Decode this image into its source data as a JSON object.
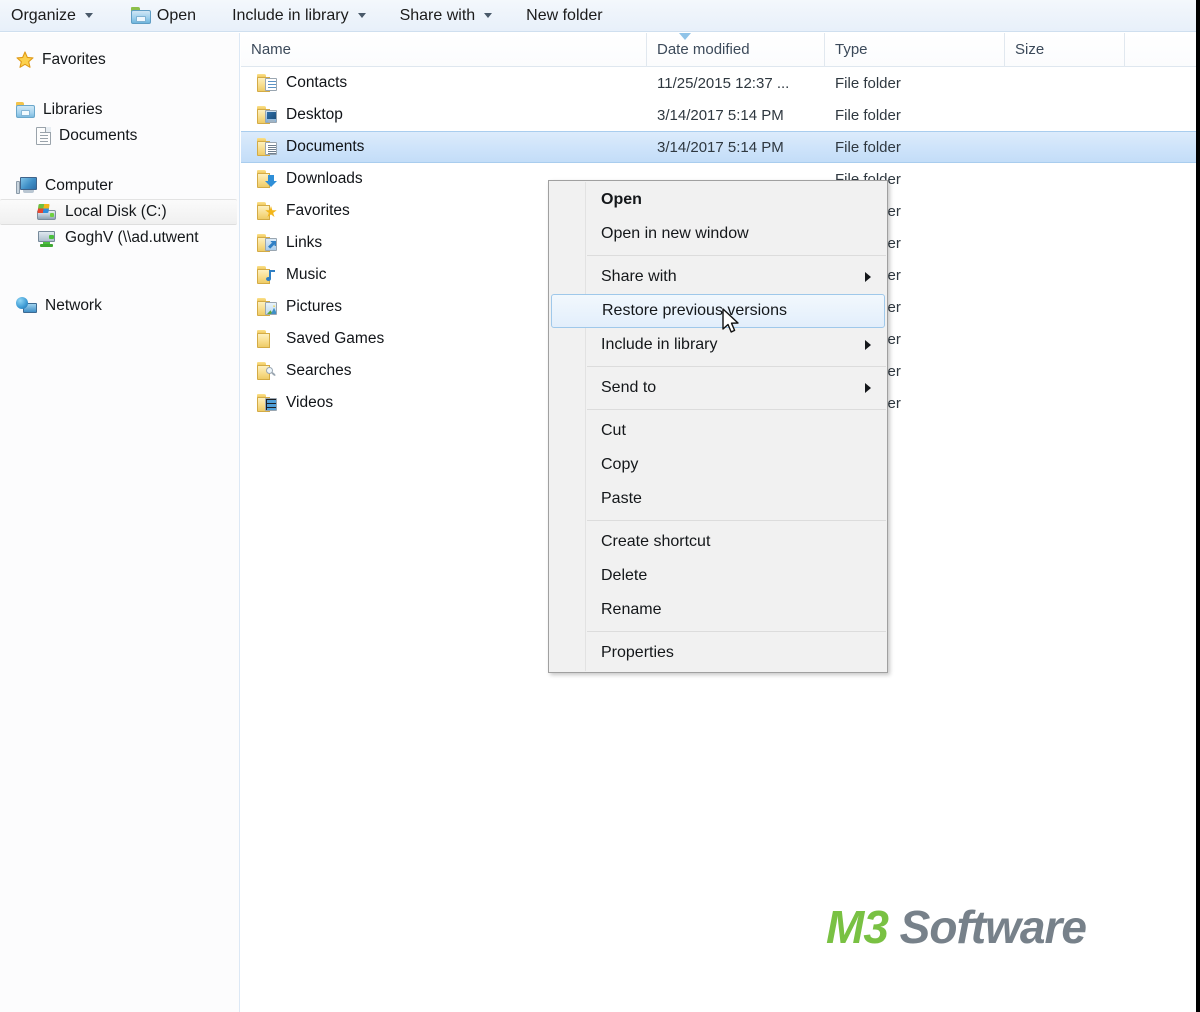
{
  "toolbar": {
    "items": [
      {
        "label": "Organize",
        "caret": true,
        "icon": null
      },
      {
        "label": "Open",
        "caret": false,
        "icon": "open-folder-icon"
      },
      {
        "label": "Include in library",
        "caret": true,
        "icon": null
      },
      {
        "label": "Share with",
        "caret": true,
        "icon": null
      },
      {
        "label": "New folder",
        "caret": false,
        "icon": null
      }
    ]
  },
  "sidebar": {
    "groups": [
      {
        "label": "Favorites",
        "icon": "star-icon",
        "selected": false
      },
      {
        "label": "Libraries",
        "icon": "library-folder-icon",
        "selected": false
      },
      {
        "label": "Documents",
        "icon": "document-icon",
        "selected": false,
        "child": true
      },
      {
        "label": "Computer",
        "icon": "computer-icon",
        "selected": false
      },
      {
        "label": "Local Disk (C:)",
        "icon": "hard-drive-icon",
        "selected": true,
        "child": true
      },
      {
        "label": "GoghV (\\\\ad.utwent",
        "icon": "network-drive-icon",
        "selected": false,
        "child": true
      },
      {
        "label": "Network",
        "icon": "network-globe-icon",
        "selected": false
      }
    ]
  },
  "list": {
    "columns": [
      {
        "label": "Name",
        "sorted": true,
        "sort_direction": "ascending"
      },
      {
        "label": "Date modified",
        "sorted": false
      },
      {
        "label": "Type",
        "sorted": false
      },
      {
        "label": "Size",
        "sorted": false
      }
    ],
    "rows": [
      {
        "name": "Contacts",
        "date": "11/25/2015 12:37 ...",
        "type": "File folder",
        "size": "",
        "icon": "folder-contacts-icon",
        "selected": false
      },
      {
        "name": "Desktop",
        "date": "3/14/2017 5:14 PM",
        "type": "File folder",
        "size": "",
        "icon": "folder-desktop-icon",
        "selected": false
      },
      {
        "name": "Documents",
        "date": "3/14/2017 5:14 PM",
        "type": "File folder",
        "size": "",
        "icon": "folder-documents-icon",
        "selected": true
      },
      {
        "name": "Downloads",
        "date": "",
        "type": "File folder",
        "size": "",
        "icon": "folder-downloads-icon",
        "selected": false
      },
      {
        "name": "Favorites",
        "date": "",
        "type": "File folder",
        "size": "",
        "icon": "folder-favorites-icon",
        "selected": false
      },
      {
        "name": "Links",
        "date": "",
        "type": "File folder",
        "size": "",
        "icon": "folder-links-icon",
        "selected": false
      },
      {
        "name": "Music",
        "date": "",
        "type": "File folder",
        "size": "",
        "icon": "folder-music-icon",
        "selected": false
      },
      {
        "name": "Pictures",
        "date": "",
        "type": "File folder",
        "size": "",
        "icon": "folder-pictures-icon",
        "selected": false
      },
      {
        "name": "Saved Games",
        "date": "",
        "type": "File folder",
        "size": "",
        "icon": "folder-saved-icon",
        "selected": false
      },
      {
        "name": "Searches",
        "date": "",
        "type": "File folder",
        "size": "",
        "icon": "folder-searches-icon",
        "selected": false
      },
      {
        "name": "Videos",
        "date": "",
        "type": "File folder",
        "size": "",
        "icon": "folder-videos-icon",
        "selected": false
      }
    ]
  },
  "context_menu": {
    "items": [
      {
        "label": "Open",
        "bold": true,
        "submenu": false,
        "highlighted": false
      },
      {
        "label": "Open in new window",
        "bold": false,
        "submenu": false,
        "highlighted": false
      },
      {
        "separator": true
      },
      {
        "label": "Share with",
        "bold": false,
        "submenu": true,
        "highlighted": false
      },
      {
        "label": "Restore previous versions",
        "bold": false,
        "submenu": false,
        "highlighted": true
      },
      {
        "label": "Include in library",
        "bold": false,
        "submenu": true,
        "highlighted": false
      },
      {
        "separator": true
      },
      {
        "label": "Send to",
        "bold": false,
        "submenu": true,
        "highlighted": false
      },
      {
        "separator": true
      },
      {
        "label": "Cut",
        "bold": false,
        "submenu": false,
        "highlighted": false
      },
      {
        "label": "Copy",
        "bold": false,
        "submenu": false,
        "highlighted": false
      },
      {
        "label": "Paste",
        "bold": false,
        "submenu": false,
        "highlighted": false
      },
      {
        "separator": true
      },
      {
        "label": "Create shortcut",
        "bold": false,
        "submenu": false,
        "highlighted": false
      },
      {
        "label": "Delete",
        "bold": false,
        "submenu": false,
        "highlighted": false
      },
      {
        "label": "Rename",
        "bold": false,
        "submenu": false,
        "highlighted": false
      },
      {
        "separator": true
      },
      {
        "label": "Properties",
        "bold": false,
        "submenu": false,
        "highlighted": false
      }
    ]
  },
  "watermark": {
    "brand": "M3",
    "product": "Software"
  },
  "colors": {
    "brand_green": "#79c143",
    "brand_gray": "#77818a",
    "selection_blue": "#cfe4fa",
    "selection_border": "#a9cdee",
    "menu_bg": "#f1f1f1",
    "toolbar_bg": "#eef4fb"
  }
}
